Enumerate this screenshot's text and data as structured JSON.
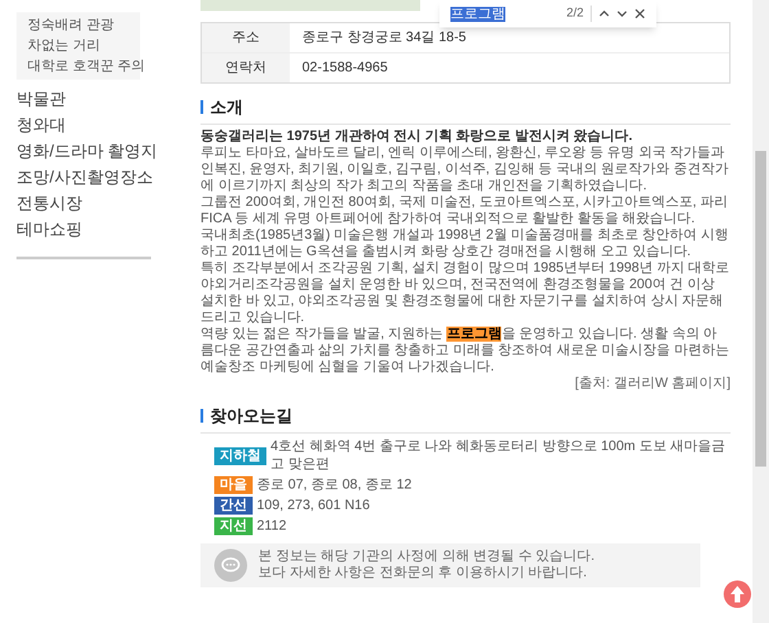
{
  "sidebar": {
    "sub_items": [
      {
        "label": "정숙배려 관광"
      },
      {
        "label": "차없는 거리"
      },
      {
        "label": "대학로 호객꾼 주의"
      }
    ],
    "items": [
      {
        "label": "박물관"
      },
      {
        "label": "청와대"
      },
      {
        "label": "영화/드라마 촬영지"
      },
      {
        "label": "조망/사진촬영장소"
      },
      {
        "label": "전통시장"
      },
      {
        "label": "테마쇼핑"
      }
    ]
  },
  "find_bar": {
    "query": "프로그램",
    "count": "2/2"
  },
  "info_table": [
    {
      "label": "주소",
      "value": "종로구 창경궁로 34길 18-5"
    },
    {
      "label": "연락처",
      "value": "02-1588-4965"
    }
  ],
  "intro": {
    "title": "소개",
    "lead": "동숭갤러리는 1975년 개관하여 전시 기획 화랑으로 발전시켜 왔습니다.",
    "paragraphs": [
      {
        "parts": [
          {
            "text": "루피노 타마요, 살바도르 달리, 엔릭 이루에스테, 왕환신, 루오왕 등 유명 외국 작가들과인복진, 윤영자, 최기원, 이일호, 김구림, 이석주, 김잉해 등 국내의 원로작가와 중견작가에 이르기까지 최상의 작가 최고의 작품을 초대 개인전을 기획하였습니다.",
            "highlighted": false
          }
        ]
      },
      {
        "parts": [
          {
            "text": "그룹전 200여회, 개인전 80여회, 국제 미술전, 도코아트엑스포, 시카고아트엑스포, 파리FICA 등 세계 유명 아트페어에 참가하여 국내외적으로 활발한 활동을 해왔습니다.",
            "highlighted": false
          }
        ]
      },
      {
        "parts": [
          {
            "text": "국내최초(1985년3월) 미술은행 개설과 1998년 2월 미술품경매를 최초로 창안하여 시행하고 2011년에는 G옥션을 출범시켜 화랑 상호간 경매전을 시행해 오고 있습니다.",
            "highlighted": false
          }
        ]
      },
      {
        "parts": [
          {
            "text": "특히 조각부분에서 조각공원 기획, 설치 경험이 많으며 1985년부터 1998년 까지 대학로 야외거리조각공원을 설치 운영한 바 있으며, 전국전역에 환경조형물을 200여 건 이상 설치한 바 있고, 야외조각공원 및 환경조형물에 대한 자문기구를 설치하여 상시 자문해 드리고 있습니다.",
            "highlighted": false
          }
        ]
      },
      {
        "parts": [
          {
            "text": "역량 있는 젊은 작가들을 발굴, 지원하는 ",
            "highlighted": false
          },
          {
            "text": "프로그램",
            "highlighted": true
          },
          {
            "text": "을 운영하고 있습니다. 생활 속의 아름다운 공간연출과 삶의 가치를 창출하고 미래를 창조하여 새로운 미술시장을 마련하는 예술창조 마케팅에 심혈을 기울여 나가겠습니다.",
            "highlighted": false
          }
        ]
      }
    ],
    "source": "[출처: 갤러리W 홈페이지]"
  },
  "directions": {
    "title": "찾아오는길",
    "routes": [
      {
        "tag": "지하철",
        "color": "#1a9bc0",
        "text": "4호선 혜화역 4번 출구로 나와 혜화동로터리 방향으로 100m 도보 새마을금고 맞은편"
      },
      {
        "tag": "마을",
        "color": "#f5841f",
        "text": "종로 07, 종로 08, 종로 12"
      },
      {
        "tag": "간선",
        "color": "#2f5fad",
        "text": "109, 273, 601 N16"
      },
      {
        "tag": "지선",
        "color": "#3ab54a",
        "text": "2112"
      }
    ]
  },
  "notice": [
    "본 정보는 해당 기관의 사정에 의해 변경될 수 있습니다.",
    "보다 자세한 사항은 전화문의 후 이용하시기 바랍니다."
  ]
}
